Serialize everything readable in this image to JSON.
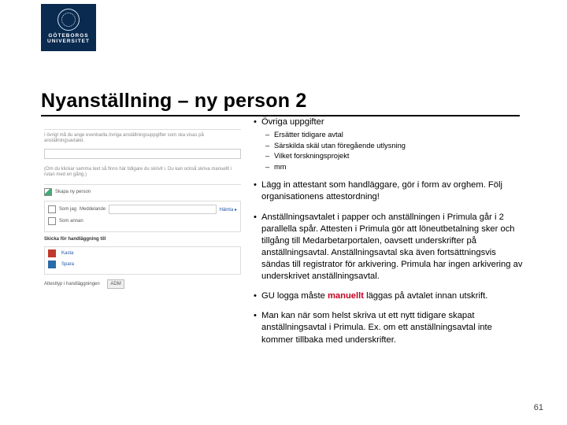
{
  "logo": {
    "line1": "GÖTEBORGS",
    "line2": "UNIVERSITET"
  },
  "title": "Nyanställning – ny person 2",
  "page_number": "61",
  "bullets": {
    "b0": {
      "label": "Övriga uppgifter",
      "sub": {
        "s0": "Ersätter tidigare avtal",
        "s1": "Särskilda skäl utan föregående utlysning",
        "s2": "Vilket forskningsprojekt",
        "s3": "mm"
      }
    },
    "b1": "Lägg in attestant som handläggare, gör i form av orghem. Följ organisationens attestordning!",
    "b2": "Anställningsavtalet i papper och anställningen i Primula går i 2 parallella spår. Attesten i Primula gör att löneutbetalning sker och tillgång till Medarbetarportalen, oavsett underskrifter på anställningsavtal. Anställningsavtal ska även fortsättningsvis sändas till registrator för arkivering. Primula har ingen arkivering av underskrivet anställningsavtal.",
    "b3_pre": "GU logga måste ",
    "b3_em": "manuellt",
    "b3_post": " läggas på avtalet innan utskrift.",
    "b4": "Man kan när som helst skriva ut ett nytt tidigare skapat anställningsavtal i Primula. Ex. om ett anställningsavtal inte kommer tillbaka med underskrifter."
  },
  "mock": {
    "skapa": "Skapa ny person",
    "kasta": "Kasta",
    "spara": "Spara",
    "skicka": "Skicka för handläggning till",
    "drop": "ADM"
  }
}
